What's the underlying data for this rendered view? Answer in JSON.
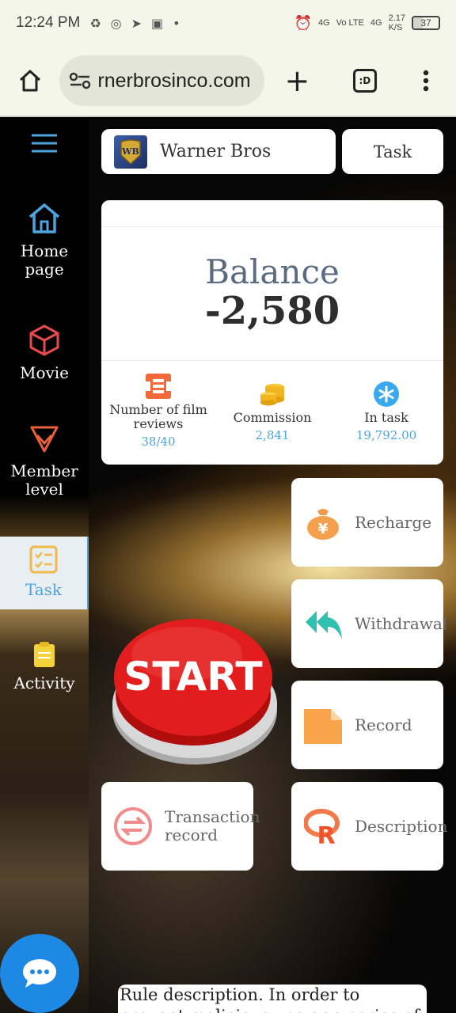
{
  "status_bar": {
    "time": "12:24 PM",
    "network": "4G",
    "volte": "Vo LTE",
    "network2": "4G",
    "speed": "2.17",
    "speed_unit": "K/S",
    "battery": "37"
  },
  "browser": {
    "url": "rnerbrosinco.com",
    "tabs_label": ":D"
  },
  "sidebar": {
    "items": [
      {
        "label": "Home page",
        "icon": "home-icon"
      },
      {
        "label": "Movie",
        "icon": "cube-icon"
      },
      {
        "label": "Member level",
        "icon": "diamond-icon"
      },
      {
        "label": "Task",
        "icon": "checklist-icon"
      },
      {
        "label": "Activity",
        "icon": "clipboard-icon"
      }
    ],
    "active_color": "#4fa3dd"
  },
  "header": {
    "brand": "Warner Bros",
    "task_button": "Task"
  },
  "balance": {
    "label": "Balance",
    "amount": "-2,580",
    "stats": [
      {
        "label": "Number of film reviews",
        "value": "38/40"
      },
      {
        "label": "Commission",
        "value": "2,841"
      },
      {
        "label": "In task",
        "value": "19,792.00"
      }
    ]
  },
  "actions": {
    "recharge": "Recharge",
    "withdrawal": "Withdrawal",
    "record": "Record",
    "transaction": "Transaction record",
    "description": "Description",
    "start": "START"
  },
  "rule": {
    "line1": "Rule description. In order to",
    "line2": "prevent malicious use or a series of"
  }
}
